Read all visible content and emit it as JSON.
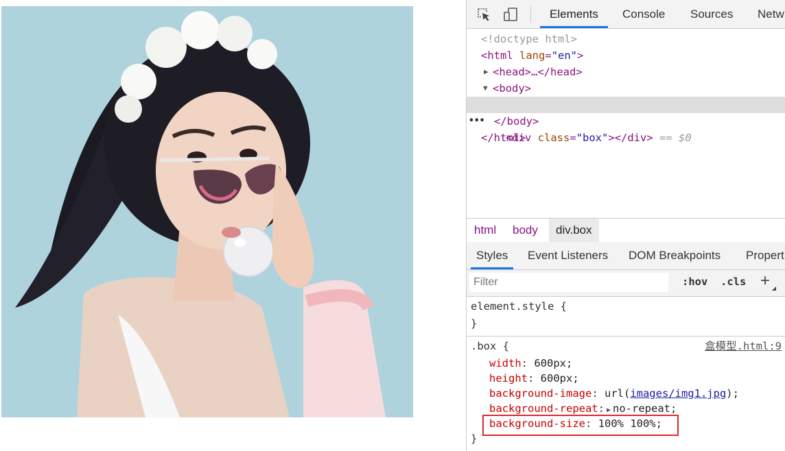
{
  "devtools": {
    "tabs": [
      "Elements",
      "Console",
      "Sources",
      "Netw"
    ],
    "dom": {
      "doctype": "<!doctype html>",
      "html_open_tag": "<html",
      "html_attr": "lang",
      "html_attr_val": "\"en\"",
      "head": "<head>…</head>",
      "body_open": "<body>",
      "div_open": "<div",
      "div_attr": "class",
      "div_attr_val": "\"box\"",
      "div_close": "></div>",
      "selected_suffix": "== $0",
      "body_close": "</body>",
      "html_close": "</html>"
    },
    "breadcrumbs": [
      "html",
      "body",
      "div.box"
    ],
    "subtabs": [
      "Styles",
      "Event Listeners",
      "DOM Breakpoints",
      "Propert"
    ],
    "filter": {
      "placeholder": "Filter",
      "hov": ":hov",
      "cls": ".cls",
      "add": "+"
    },
    "element_style": {
      "selector": "element.style {",
      "close": "}"
    },
    "box_rule": {
      "selector": ".box {",
      "source": "盒模型.html:9",
      "declarations": [
        {
          "prop": "width",
          "value": "600px;"
        },
        {
          "prop": "height",
          "value": "600px;"
        },
        {
          "prop": "background-image",
          "value_prefix": "url(",
          "link": "images/img1.jpg",
          "value_suffix": ");"
        },
        {
          "prop": "background-repeat",
          "value": "no-repeat;"
        },
        {
          "prop": "background-size",
          "value": "100% 100%;"
        }
      ],
      "close": "}"
    }
  },
  "colors": {
    "accent": "#1a73e8",
    "highlight": "#e0262b",
    "tag": "#881280",
    "attr": "#994500",
    "value": "#1a1aa6",
    "prop": "#c80000"
  }
}
